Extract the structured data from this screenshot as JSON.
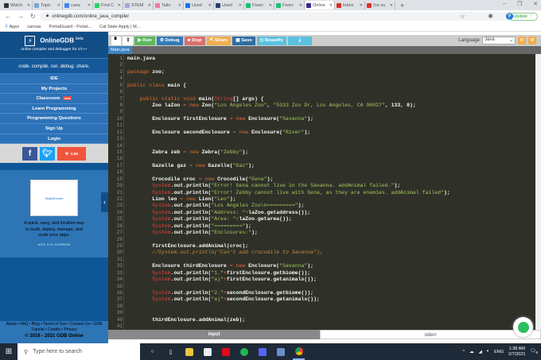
{
  "browser": {
    "tabs": [
      {
        "label": "Watch",
        "color": "#333"
      },
      {
        "label": "Topic",
        "color": "#7aa6d8"
      },
      {
        "label": "csea",
        "color": "#4285f4"
      },
      {
        "label": "Find C",
        "color": "#25d366"
      },
      {
        "label": "STEM",
        "color": "#b39ddb"
      },
      {
        "label": "Tallo",
        "color": "#e57fa0"
      },
      {
        "label": "Used",
        "color": "#1a73e8"
      },
      {
        "label": "Used",
        "color": "#2c3e70"
      },
      {
        "label": "Fiverr",
        "color": "#1dbf73"
      },
      {
        "label": "Fiverr",
        "color": "#1dbf73"
      },
      {
        "label": "Online",
        "color": "#3a2a8a",
        "active": true
      },
      {
        "label": "Inbox",
        "color": "#d93025"
      },
      {
        "label": "(no su",
        "color": "#d93025"
      }
    ],
    "new_tab": "+",
    "url": "onlinegdb.com/online_java_compiler",
    "update_label": "Update",
    "avatar": "M",
    "bookmarks": [
      "Apps",
      "canvas",
      "PortalGuard - Portal...",
      "Cal State Apply | M..."
    ]
  },
  "sidebar": {
    "brand": "OnlineGDB",
    "beta": "beta",
    "subtitle": "online compiler and debugger for c/c++",
    "tagline": "code. compile. run. debug. share.",
    "nav": [
      {
        "label": "IDE"
      },
      {
        "label": "My Projects"
      },
      {
        "label": "Classroom",
        "badge": "new"
      },
      {
        "label": "Learn Programming"
      },
      {
        "label": "Programming Questions"
      },
      {
        "label": "Sign Up"
      },
      {
        "label": "Login"
      }
    ],
    "share_count": "5.8K",
    "ad": {
      "logo_text": "DigitalOcean",
      "text": "A quick, easy, and intuitive way to build, deploy, manage, and scale your apps.",
      "via": "ADS VIA CARBON"
    },
    "footer": {
      "links": "About • FAQ • Blog • Terms of Use • Contact Us • GDB Tutorial • Credits • Privacy",
      "copyright": "© 2016 - 2021 GDB Online"
    }
  },
  "toolbar": {
    "run": "Run",
    "debug": "Debug",
    "stop": "Stop",
    "share": "Share",
    "save": "Save",
    "beautify": "{} Beautify",
    "language_label": "Language",
    "language": "Java"
  },
  "file_tab": "Main.java",
  "code": [
    "main.java",
    "",
    "package zoo;",
    "",
    "public class main {",
    "",
    "    public static void main(String[] args) {",
    "        Zoo laZoo = new Zoo(\"Los Angeles Zoo\", \"5333 Zoo Dr, Los Angeles, CA 90027\", 133, 8);",
    "",
    "        Enclosure firstEnclosure = new Enclosure(\"Savanna\");",
    "",
    "        Enclosure secondEnclosure = new Enclosure(\"River\");",
    "",
    "",
    "        Zebra zeb = new Zebra(\"Zebby\");",
    "",
    "        Gazelle gaz = new Gazelle(\"Gaz\");",
    "",
    "        Crocodile croc = new Crocodile(\"Gena\");",
    "        System.out.println(\"Error! Gena cannot live in the Savanna. addAnimal failed.\");",
    "        System.out.println(\"Error! Zebby cannot live with Gena, as they are enemies. addAnimal failed\");",
    "        Lion leo = new Lion(\"Leo\");",
    "        System.out.println(\"Los Angeles Zoo\\n=========\");",
    "        System.out.println(\"Address: \"+laZoo.getaddress());",
    "        System.out.println(\"Area: \"+laZoo.getarea());",
    "        System.out.println(\"=========\");",
    "        System.out.println(\"Enclosures:\");",
    "",
    "        firstEnclosure.addAnimal(croc);",
    "        //System.out.println(\"Can't add crocodile to Savanna\");",
    "",
    "        Enclosure thirdEnclosure = new Enclosure(\"Savanna\");",
    "        System.out.println(\"1.\"+firstEnclosure.getbiome());",
    "        System.out.println(\"a)\"+firstEnclosure.getanimals());",
    "",
    "        System.out.println(\"2.\"+secondEnclosure.getbiome());",
    "        System.out.println(\"a)\"+secondEnclosure.getanimals());",
    "",
    "",
    "        thirdEnclosure.addAnimal(zeb);",
    ""
  ],
  "io": {
    "input": "input",
    "stderr": "stderr"
  },
  "taskbar": {
    "search_placeholder": "Type here to search",
    "lang": "ENG",
    "time": "1:38 AM",
    "date": "2/7/2021",
    "notifications": "6"
  }
}
